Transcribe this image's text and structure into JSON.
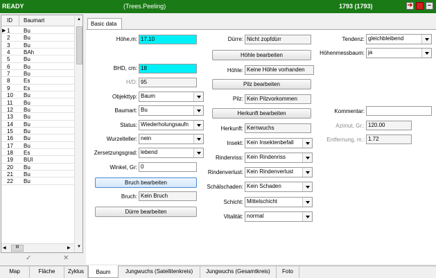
{
  "titlebar": {
    "status": "READY",
    "context": "(Trees.Peeling)",
    "record": "1793 (1793)"
  },
  "grid": {
    "columns": [
      "ID",
      "Baumart"
    ],
    "rows": [
      {
        "id": "1",
        "art": "Bu"
      },
      {
        "id": "2",
        "art": "Bu"
      },
      {
        "id": "3",
        "art": "Bu"
      },
      {
        "id": "4",
        "art": "BAh"
      },
      {
        "id": "5",
        "art": "Bu"
      },
      {
        "id": "6",
        "art": "Bu"
      },
      {
        "id": "7",
        "art": "Bu"
      },
      {
        "id": "8",
        "art": "Es"
      },
      {
        "id": "9",
        "art": "Es"
      },
      {
        "id": "10",
        "art": "Bu"
      },
      {
        "id": "11",
        "art": "Bu"
      },
      {
        "id": "12",
        "art": "Bu"
      },
      {
        "id": "13",
        "art": "Bu"
      },
      {
        "id": "14",
        "art": "Bu"
      },
      {
        "id": "15",
        "art": "Bu"
      },
      {
        "id": "16",
        "art": "Bu"
      },
      {
        "id": "17",
        "art": "Bu"
      },
      {
        "id": "18",
        "art": "Es"
      },
      {
        "id": "19",
        "art": "BUI"
      },
      {
        "id": "20",
        "art": "Bu"
      },
      {
        "id": "21",
        "art": "Bu"
      },
      {
        "id": "22",
        "art": "Bu"
      }
    ],
    "scroll_label": "III"
  },
  "tab": {
    "label": "Basic data"
  },
  "form": {
    "hoehe_label": "Höhe,m:",
    "hoehe_value": "17.10",
    "bhd_label": "BHD, cm:",
    "bhd_value": "18",
    "hd_label": "H/D:",
    "hd_value": "95",
    "objekttyp_label": "Objekttyp:",
    "objekttyp_value": "Baum",
    "baumart_label": "Baumart:",
    "baumart_value": "Bu",
    "status_label": "Status:",
    "status_value": "Wiederholungsaufn",
    "wurzelteller_label": "Wurzelteller:",
    "wurzelteller_value": "nein",
    "zersetzung_label": "Zersetzungsgrad:",
    "zersetzung_value": "lebend",
    "winkel_label": "Winkel, Gr:",
    "winkel_value": "0",
    "bruch_button": "Bruch bearbeiten",
    "bruch_label": "Bruch:",
    "bruch_value": "Kein Bruch",
    "duerre_button": "Dürre bearbeiten",
    "duerre_label": "Dürre:",
    "duerre_value": "Nicht zopfdürr",
    "hoehle_button": "Höhle bearbeiten",
    "hoehle_label": "Höhle:",
    "hoehle_value": "Keine Höhle vorhanden",
    "pilz_button": "Pilz bearbeiten",
    "pilz_label": "Pilz:",
    "pilz_value": "Kein Pilzvorkommen",
    "herkunft_button": "Herkunft bearbeiten",
    "herkunft_label": "Herkunft:",
    "herkunft_value": "Kernwuchs",
    "insekt_label": "Insekt:",
    "insekt_value": "Kein Insektenbefall",
    "rindenriss_label": "Rindenriss:",
    "rindenriss_value": "Kein Rindenriss",
    "rindenverlust_label": "Rindenverlust:",
    "rindenverlust_value": "Kein Rindenverlust",
    "schaelschaden_label": "Schälschaden:",
    "schaelschaden_value": "Kein Schaden",
    "schicht_label": "Schicht:",
    "schicht_value": "Mittelschicht",
    "vitalitaet_label": "Vitalität:",
    "vitalitaet_value": "normal",
    "tendenz_label": "Tendenz:",
    "tendenz_value": "gleichbleibend",
    "hoehenmess_label": "Höhenmessbaum:",
    "hoehenmess_value": "ja",
    "kommentar_label": "Kommentar:",
    "kommentar_value": "",
    "azimut_label": "Azimut, Gr.:",
    "azimut_value": "120.00",
    "entfernung_label": "Entfernung, m.:",
    "entfernung_value": "1.72"
  },
  "bottom_tabs": [
    "Map",
    "Fläche",
    "Zyklus",
    "Baum",
    "Jungwuchs (Satellitenkreis)",
    "Jungwuchs (Gesamtkreis)",
    "Foto"
  ],
  "colors": {
    "titlebar": "#1a7a16",
    "highlight_field": "#00f0f8"
  }
}
